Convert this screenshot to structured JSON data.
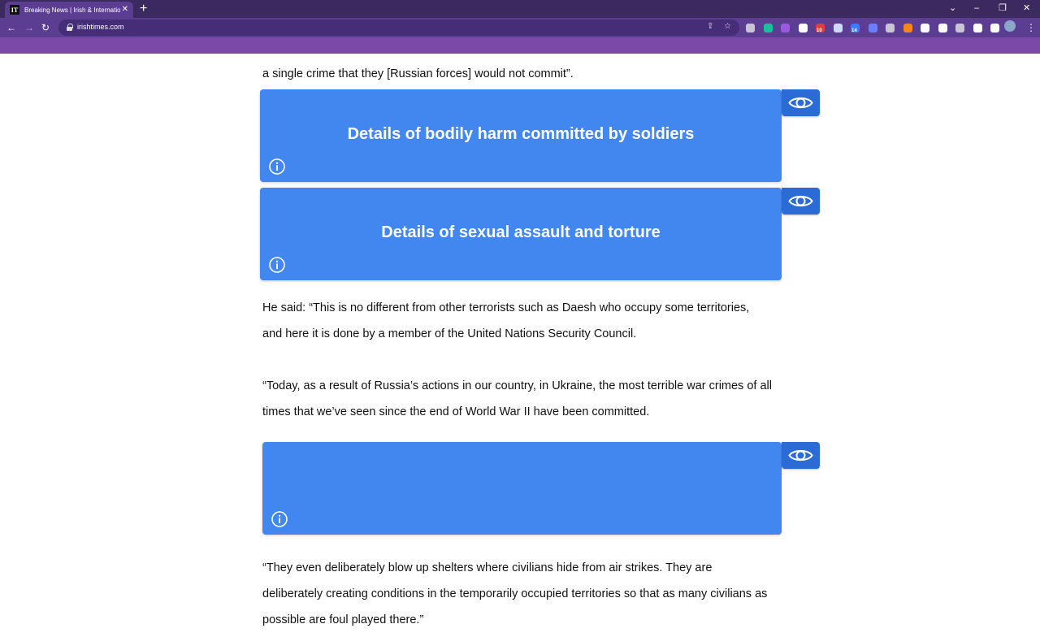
{
  "browser": {
    "tab_title": "Breaking News | Irish & International",
    "tab_favicon": "IT",
    "url": "irishtimes.com",
    "extensions": [
      {
        "icon": "ext-gray-icon",
        "color": "#c9c3d6"
      },
      {
        "icon": "grammarly-icon",
        "color": "#15c39a"
      },
      {
        "icon": "ext-purple-icon",
        "color": "#9b59e0"
      },
      {
        "icon": "ext-fx-icon",
        "color": "#ffffff"
      },
      {
        "icon": "ext-red-icon",
        "color": "#e23c3c",
        "badge": "10"
      },
      {
        "icon": "ext-pen-icon",
        "color": "#cfd8ff"
      },
      {
        "icon": "ext-blue-icon",
        "color": "#3a7bff",
        "badge": "14"
      },
      {
        "icon": "ext-arrow-icon",
        "color": "#6a7dff"
      },
      {
        "icon": "ext-shield-icon",
        "color": "#c9c3d6"
      },
      {
        "icon": "metamask-icon",
        "color": "#f6851b"
      },
      {
        "icon": "notion-icon",
        "color": "#ffffff"
      },
      {
        "icon": "ext-cloud-icon",
        "color": "#ffffff"
      },
      {
        "icon": "ext-camera-icon",
        "color": "#c9c3d6"
      },
      {
        "icon": "puzzle-icon",
        "color": "#ffffff"
      },
      {
        "icon": "sidepanel-icon",
        "color": "#ffffff"
      }
    ]
  },
  "article": {
    "p0": "a single crime that they [Russian forces] would not commit”.",
    "card1_title": "Details of bodily harm committed by soldiers",
    "card2_title": "Details of sexual assault and torture",
    "p1_line1": "He said: “This is no different from other terrorists such as Daesh who occupy some territories,",
    "p1_line2": "and here it is done by a member of the United Nations Security Council.",
    "p2_line1": "“Today, as a result of Russia’s actions in our country, in Ukraine, the most terrible war crimes of all",
    "p2_line2": "times that we’ve seen since the end of World War II have been committed.",
    "p3_line1": "“They even deliberately blow up shelters where civilians hide from air strikes. They are",
    "p3_line2": "deliberately creating conditions in the temporarily occupied territories so that as many civilians as",
    "p3_line3": "possible are foul played there.”"
  },
  "colors": {
    "chrome_dark": "#3a2a60",
    "chrome": "#5b3d91",
    "bookmark_bar": "#7b4aa8",
    "card_blue": "#4287f0",
    "eye_blue": "#2a6bd6"
  }
}
